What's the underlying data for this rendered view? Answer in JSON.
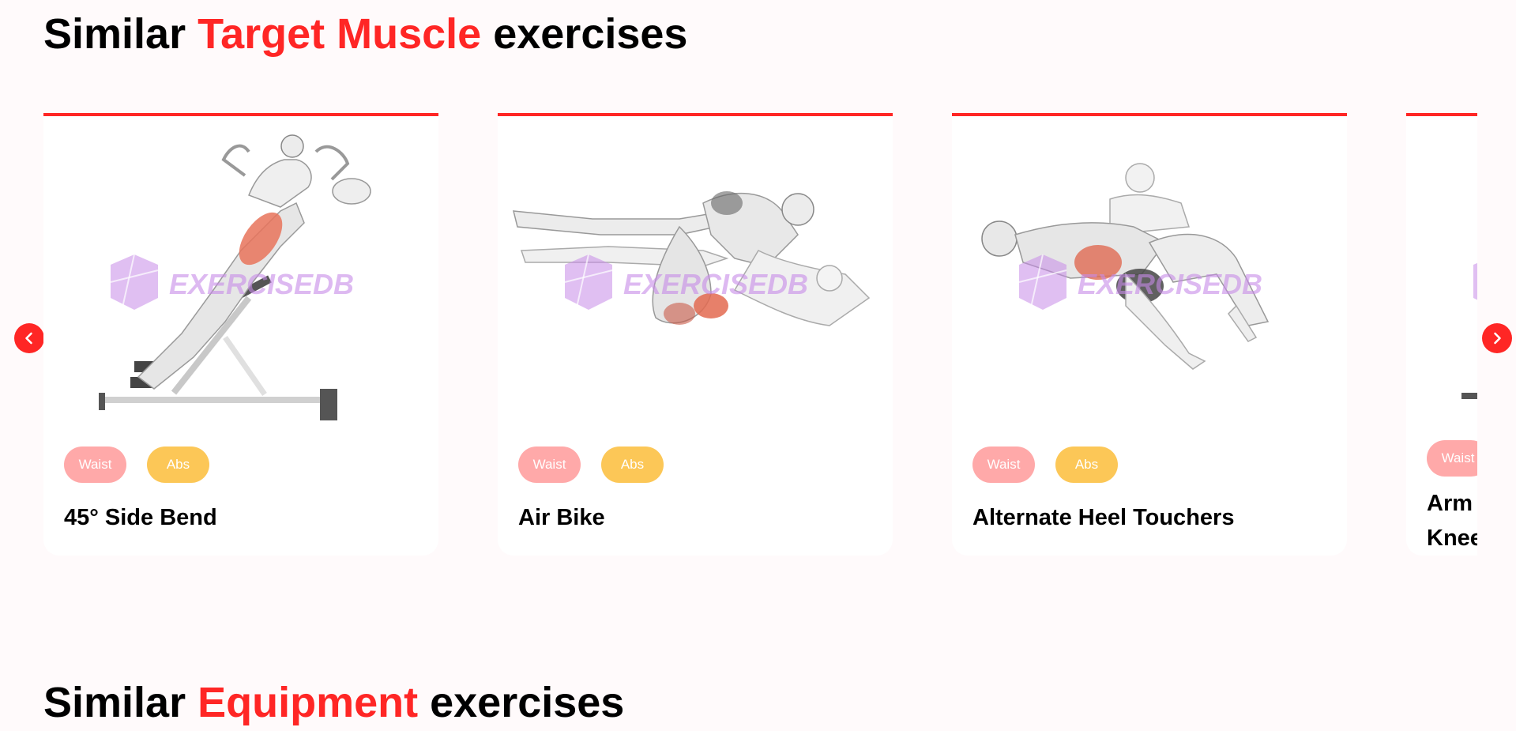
{
  "sections": {
    "target": {
      "title_prefix": "Similar ",
      "title_accent": "Target Muscle",
      "title_suffix": " exercises"
    },
    "equipment": {
      "title_prefix": "Similar ",
      "title_accent": "Equipment",
      "title_suffix": " exercises"
    }
  },
  "watermark": "EXERCISEDB",
  "cards": [
    {
      "body_part": "Waist",
      "target": "Abs",
      "name": "45° Side Bend",
      "image_icon": "hyperextension-bench-exercise-illustration"
    },
    {
      "body_part": "Waist",
      "target": "Abs",
      "name": "Air Bike",
      "image_icon": "lying-crunch-exercise-illustration"
    },
    {
      "body_part": "Waist",
      "target": "Abs",
      "name": "Alternate Heel Touchers",
      "image_icon": "lying-heel-touch-exercise-illustration"
    },
    {
      "body_part": "Waist",
      "target": "",
      "name": "Arm Slide\nKnee",
      "image_icon": "floor-exercise-illustration"
    }
  ],
  "icons": {
    "prev": "chevron-left-icon",
    "next": "chevron-right-icon"
  },
  "colors": {
    "accent": "#ff2625",
    "body_part_tag": "#ffa9a9",
    "target_tag": "#fcc757",
    "watermark": "#c78be8",
    "background": "#fffafb"
  }
}
